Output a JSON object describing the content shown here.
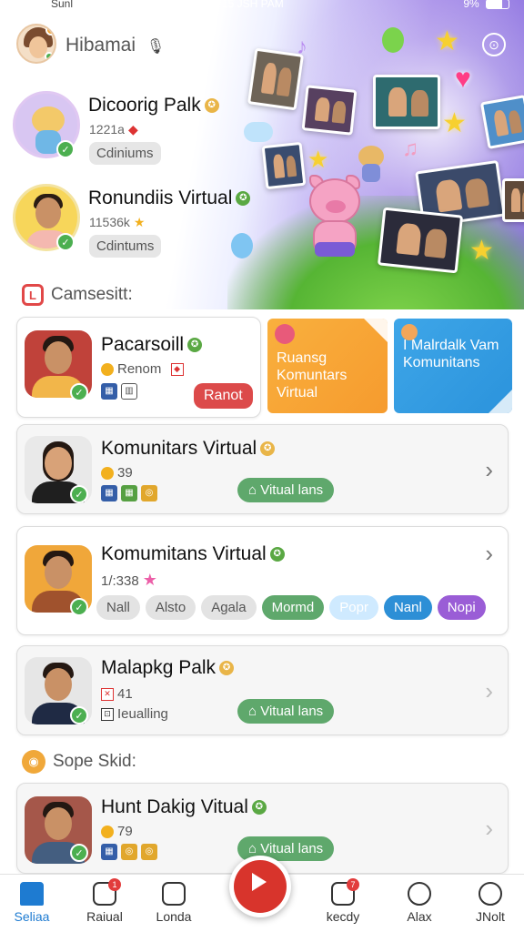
{
  "status_bar": {
    "carrier": "Sunl",
    "time": "15 JSH PAM",
    "battery": "9%"
  },
  "top_bar": {
    "title": "Hibamai"
  },
  "featured_users": [
    {
      "name": "Dicoorig Palk",
      "count": "1221a",
      "chip": "Cdiniums"
    },
    {
      "name": "Ronundiis Virtual",
      "count": "11536k",
      "chip": "Cdintums"
    }
  ],
  "section1": {
    "title": "Camsesitt:"
  },
  "card1": {
    "name": "Pacarsoill",
    "sub": "Renom",
    "button": "Ranot"
  },
  "promo_orange": {
    "text": "Ruansg Komuntars Virtual"
  },
  "promo_blue": {
    "text": "I Malrdalk Vam Komunitans"
  },
  "card2": {
    "name": "Komunitars Virtual",
    "count": "39",
    "button": "Vitual lans"
  },
  "card3": {
    "name": "Komumitans Virtual",
    "count": "1/:338",
    "tags": [
      "Nall",
      "Alsto",
      "Agala",
      "Mormd",
      "Popr",
      "Nanl",
      "Nopi"
    ]
  },
  "card4": {
    "name": "Malapkg Palk",
    "count": "41",
    "sub": "Ieualling",
    "button": "Vitual lans"
  },
  "section2": {
    "title": "Sope Skid:"
  },
  "card5": {
    "name": "Hunt Dakig Vitual",
    "count": "79",
    "button": "Vitual lans"
  },
  "bottom_nav": {
    "items": [
      "Seliaa",
      "Raiual",
      "Londa",
      "kecdy",
      "Alax",
      "JNolt"
    ],
    "badge_raiual": "1",
    "badge_kecdy": "7"
  },
  "colors": {
    "accent": "#1e7bd1",
    "record": "#d8342c",
    "green": "#5fa86c",
    "orange_promo": "#f9b03e",
    "blue_promo": "#3ea6e8"
  }
}
